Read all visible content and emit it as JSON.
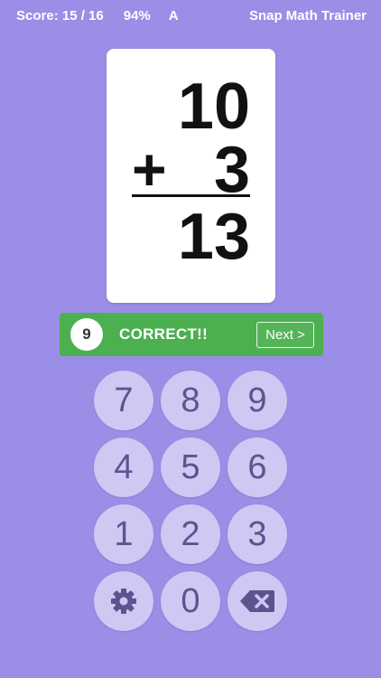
{
  "header": {
    "score": "Score: 15 / 16",
    "percent": "94%",
    "grade": "A",
    "title": "Snap Math Trainer"
  },
  "card": {
    "operand_top": "10",
    "operator": "+",
    "operand_bottom": "3",
    "answer": "13"
  },
  "feedback": {
    "badge": "9",
    "message": "CORRECT!!",
    "next_label": "Next >",
    "color": "#4caf50"
  },
  "keypad": {
    "keys": [
      {
        "label": "7"
      },
      {
        "label": "8"
      },
      {
        "label": "9"
      },
      {
        "label": "4"
      },
      {
        "label": "5"
      },
      {
        "label": "6"
      },
      {
        "label": "1"
      },
      {
        "label": "2"
      },
      {
        "label": "3"
      },
      {
        "icon": "gear-icon"
      },
      {
        "label": "0"
      },
      {
        "icon": "backspace-icon"
      }
    ]
  },
  "colors": {
    "background": "#9a8ee6",
    "key": "#cfc8f2",
    "key_text": "#5b5490"
  }
}
